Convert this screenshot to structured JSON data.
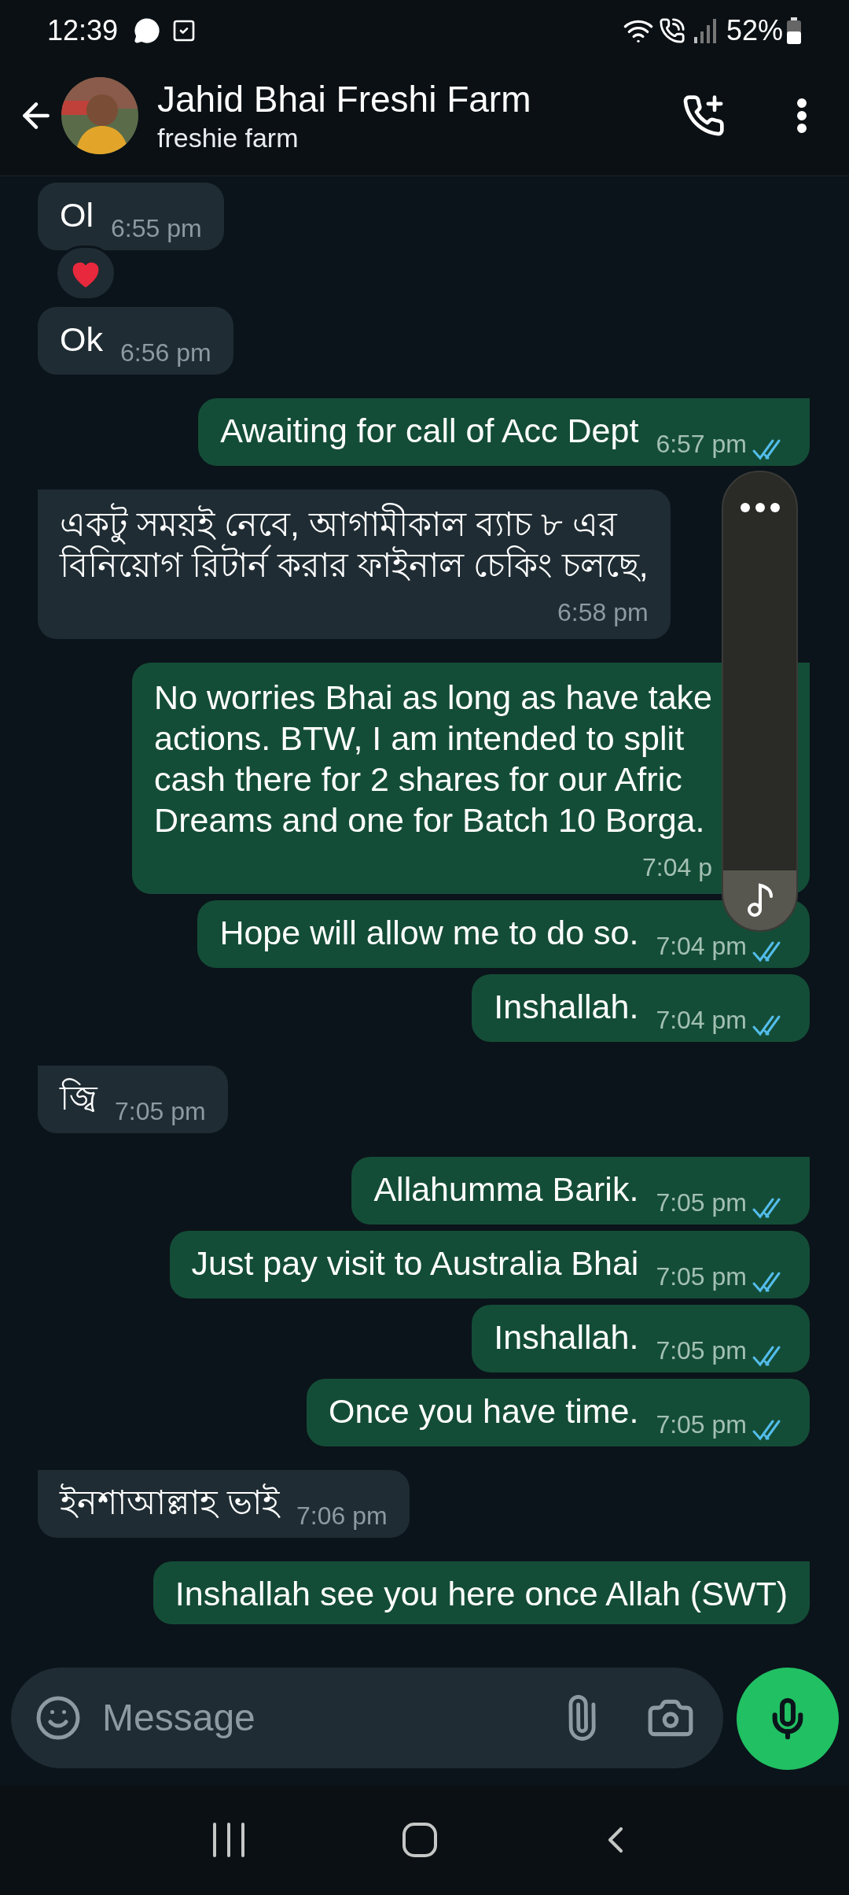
{
  "status_bar": {
    "time": "12:39",
    "battery": "52%"
  },
  "header": {
    "name": "Jahid Bhai Freshi Farm",
    "subtitle": "freshie farm"
  },
  "messages": [
    {
      "outgoing": false,
      "kind": "short",
      "tail": false,
      "text": "Ol",
      "time": "6:55 pm",
      "reacted": true
    },
    {
      "outgoing": false,
      "kind": "short",
      "tail": false,
      "text": "Ok",
      "time": "6:56 pm"
    },
    {
      "outgoing": true,
      "kind": "short",
      "tail": true,
      "text": "Awaiting for call of Acc Dept",
      "time": "6:57 pm",
      "read": true
    },
    {
      "outgoing": false,
      "kind": "long",
      "tail": true,
      "text": "একটু সময়ই নেবে, আগামীকাল ব্যাচ ৮ এর\nবিনিয়োগ রিটার্ন করার ফাইনাল চেকিং চলছে,",
      "time": "6:58 pm"
    },
    {
      "outgoing": true,
      "kind": "long",
      "tail": true,
      "text": "No worries Bhai as long as have take\nactions. BTW, I am intended to split\ncash there for 2 shares for our Afric\nDreams and one for Batch 10 Borga.",
      "time": "7:04 p"
    },
    {
      "outgoing": true,
      "kind": "short",
      "tail": false,
      "text": "Hope will allow me to do so.",
      "time": "7:04 pm",
      "read": true
    },
    {
      "outgoing": true,
      "kind": "short",
      "tail": false,
      "text": "Inshallah.",
      "time": "7:04 pm",
      "read": true
    },
    {
      "outgoing": false,
      "kind": "short",
      "tail": true,
      "text": "জ্বি",
      "time": "7:05 pm"
    },
    {
      "outgoing": true,
      "kind": "short",
      "tail": true,
      "text": "Allahumma Barik.",
      "time": "7:05 pm",
      "read": true
    },
    {
      "outgoing": true,
      "kind": "short",
      "tail": false,
      "text": "Just pay visit to Australia Bhai",
      "time": "7:05 pm",
      "read": true
    },
    {
      "outgoing": true,
      "kind": "short",
      "tail": false,
      "text": "Inshallah.",
      "time": "7:05 pm",
      "read": true
    },
    {
      "outgoing": true,
      "kind": "short",
      "tail": false,
      "text": "Once you have time.",
      "time": "7:05 pm",
      "read": true
    },
    {
      "outgoing": false,
      "kind": "short",
      "tail": true,
      "text": "ইনশাআল্লাহ ভাই",
      "time": "7:06 pm"
    },
    {
      "outgoing": true,
      "kind": "cut",
      "tail": true,
      "text": "Inshallah see you here once Allah (SWT)"
    }
  ],
  "composer": {
    "placeholder": "Message"
  }
}
